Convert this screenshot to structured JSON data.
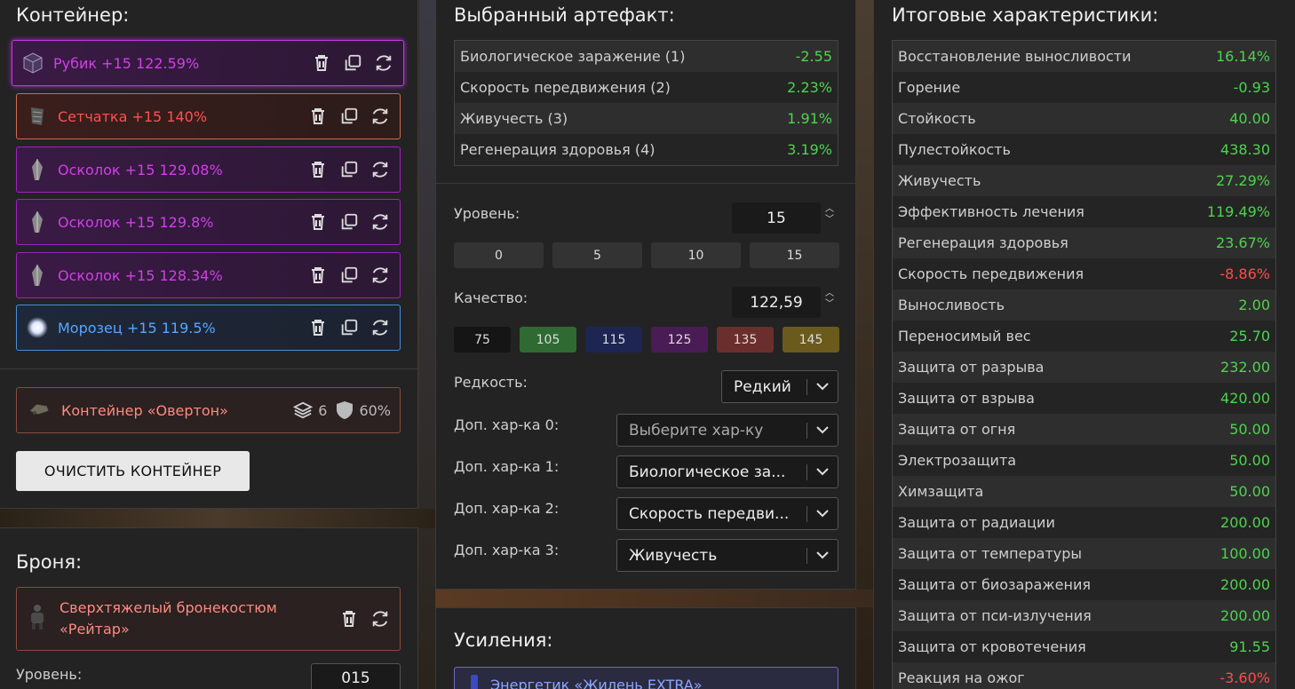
{
  "colors": {
    "positive": "#4cd44c",
    "negative": "#ff4c4c",
    "purple": "#d040e8",
    "red": "#ff5050",
    "blue": "#58a6ff"
  },
  "container": {
    "title": "Контейнер:",
    "items": [
      {
        "label": "Рубик +15 122.59%",
        "rarity": "purple",
        "icon": "cube-icon"
      },
      {
        "label": "Сетчатка +15 140%",
        "rarity": "red",
        "icon": "mesh-icon"
      },
      {
        "label": "Осколок +15 129.08%",
        "rarity": "purple",
        "icon": "shard-icon"
      },
      {
        "label": "Осколок +15 129.8%",
        "rarity": "purple",
        "icon": "shard-icon"
      },
      {
        "label": "Осколок +15 128.34%",
        "rarity": "purple",
        "icon": "shard-icon"
      },
      {
        "label": "Морозец +15 119.5%",
        "rarity": "blue",
        "icon": "frost-icon"
      }
    ],
    "box": {
      "label": "Контейнер «Овертон»",
      "slots": "6",
      "protection": "60%"
    },
    "clear_button": "ОЧИСТИТЬ КОНТЕЙНЕР"
  },
  "armor": {
    "title": "Броня:",
    "item_label": "Сверхтяжелый бронекостюм «Рейтар»",
    "level_label": "Уровень:",
    "level_value": "015"
  },
  "selected": {
    "title": "Выбранный артефакт:",
    "stats": [
      {
        "name": "Биологическое заражение (1)",
        "value": "-2.55",
        "sign": "neg"
      },
      {
        "name": "Скорость передвижения (2)",
        "value": "2.23%",
        "sign": "pos"
      },
      {
        "name": "Живучесть (3)",
        "value": "1.91%",
        "sign": "pos"
      },
      {
        "name": "Регенерация здоровья (4)",
        "value": "3.19%",
        "sign": "pos"
      }
    ],
    "level_label": "Уровень:",
    "level_value": "15",
    "level_buttons": [
      "0",
      "5",
      "10",
      "15"
    ],
    "quality_label": "Качество:",
    "quality_value": "122,59",
    "quality_buttons": [
      {
        "label": "75",
        "color": "#151515"
      },
      {
        "label": "105",
        "color": "#2f6a33"
      },
      {
        "label": "115",
        "color": "#1d2552"
      },
      {
        "label": "125",
        "color": "#4a1c55"
      },
      {
        "label": "135",
        "color": "#6a2e2c"
      },
      {
        "label": "145",
        "color": "#6a5a1c"
      }
    ],
    "rarity_label": "Редкость:",
    "rarity_value": "Редкий",
    "extra": [
      {
        "label": "Доп. хар-ка 0:",
        "value": "Выберите хар-ку",
        "placeholder": true
      },
      {
        "label": "Доп. хар-ка 1:",
        "value": "Биологическое за...",
        "placeholder": false
      },
      {
        "label": "Доп. хар-ка 2:",
        "value": "Скорость передви...",
        "placeholder": false
      },
      {
        "label": "Доп. хар-ка 3:",
        "value": "Живучесть",
        "placeholder": false
      }
    ]
  },
  "boosts": {
    "title": "Усиления:",
    "item_label": "Энергетик «Жилень EXTRA»"
  },
  "totals": {
    "title": "Итоговые характеристики:",
    "rows": [
      {
        "name": "Восстановление выносливости",
        "value": "16.14%",
        "sign": "pos"
      },
      {
        "name": "Горение",
        "value": "-0.93",
        "sign": "pos"
      },
      {
        "name": "Стойкость",
        "value": "40.00",
        "sign": "pos"
      },
      {
        "name": "Пулестойкость",
        "value": "438.30",
        "sign": "pos"
      },
      {
        "name": "Живучесть",
        "value": "27.29%",
        "sign": "pos"
      },
      {
        "name": "Эффективность лечения",
        "value": "119.49%",
        "sign": "pos"
      },
      {
        "name": "Регенерация здоровья",
        "value": "23.67%",
        "sign": "pos"
      },
      {
        "name": "Скорость передвижения",
        "value": "-8.86%",
        "sign": "neg"
      },
      {
        "name": "Выносливость",
        "value": "2.00",
        "sign": "pos"
      },
      {
        "name": "Переносимый вес",
        "value": "25.70",
        "sign": "pos"
      },
      {
        "name": "Защита от разрыва",
        "value": "232.00",
        "sign": "pos"
      },
      {
        "name": "Защита от взрыва",
        "value": "420.00",
        "sign": "pos"
      },
      {
        "name": "Защита от огня",
        "value": "50.00",
        "sign": "pos"
      },
      {
        "name": "Электрозащита",
        "value": "50.00",
        "sign": "pos"
      },
      {
        "name": "Химзащита",
        "value": "50.00",
        "sign": "pos"
      },
      {
        "name": "Защита от радиации",
        "value": "200.00",
        "sign": "pos"
      },
      {
        "name": "Защита от температуры",
        "value": "100.00",
        "sign": "pos"
      },
      {
        "name": "Защита от биозаражения",
        "value": "200.00",
        "sign": "pos"
      },
      {
        "name": "Защита от пси-излучения",
        "value": "200.00",
        "sign": "pos"
      },
      {
        "name": "Защита от кровотечения",
        "value": "91.55",
        "sign": "pos"
      },
      {
        "name": "Реакция на ожог",
        "value": "-3.60%",
        "sign": "neg"
      }
    ]
  }
}
